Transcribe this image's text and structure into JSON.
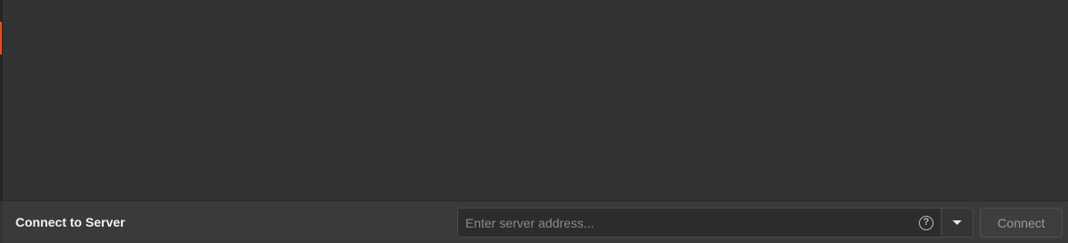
{
  "connect_bar": {
    "title": "Connect to Server",
    "address_placeholder": "Enter server address...",
    "address_value": "",
    "help_icon": "question-circle-icon",
    "dropdown_icon": "caret-down-icon",
    "connect_label": "Connect"
  },
  "colors": {
    "background": "#333333",
    "bar_background": "#3a3a3a",
    "accent": "#e8501c"
  }
}
